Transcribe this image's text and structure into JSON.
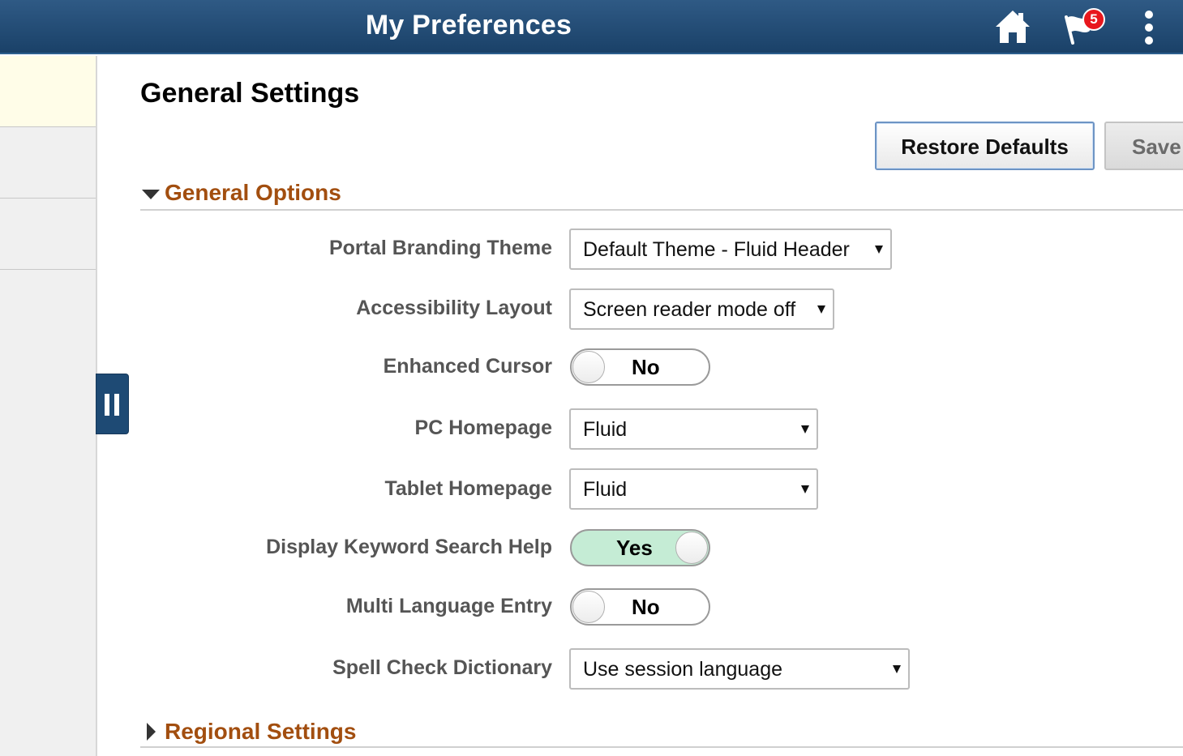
{
  "header": {
    "title": "My Preferences",
    "home_icon": "home-icon",
    "notifications_icon": "flag-icon",
    "notifications_count": "5",
    "actions_icon": "vertical-ellipsis-icon",
    "colors": {
      "bar": "#1f4a74",
      "badge": "#e8171d"
    }
  },
  "sidebar": {
    "collapse_icon": "pause-bars-icon",
    "colors": {
      "selected_item_bg": "#fffde8",
      "tab": "#1e4a74"
    }
  },
  "main": {
    "title": "General Settings",
    "actions": {
      "restore_label": "Restore Defaults",
      "save_label": "Save"
    },
    "sections": {
      "general": {
        "title": "General Options",
        "expanded": true,
        "fields": {
          "portal_branding_theme": {
            "label": "Portal Branding Theme",
            "value": "Default Theme - Fluid Header"
          },
          "accessibility_layout": {
            "label": "Accessibility Layout",
            "value": "Screen reader mode off"
          },
          "enhanced_cursor": {
            "label": "Enhanced Cursor",
            "value": "No",
            "on": false
          },
          "pc_homepage": {
            "label": "PC Homepage",
            "value": "Fluid"
          },
          "tablet_homepage": {
            "label": "Tablet Homepage",
            "value": "Fluid"
          },
          "keyword_search_help": {
            "label": "Display Keyword Search Help",
            "value": "Yes",
            "on": true
          },
          "multi_language_entry": {
            "label": "Multi Language Entry",
            "value": "No",
            "on": false
          },
          "spell_check_dictionary": {
            "label": "Spell Check Dictionary",
            "value": "Use session language"
          }
        }
      },
      "regional": {
        "title": "Regional Settings",
        "expanded": false
      }
    },
    "colors": {
      "section_title": "#a24e0f",
      "toggle_on": "#c5ecd5",
      "primary_button_border": "#6d94c4"
    }
  }
}
